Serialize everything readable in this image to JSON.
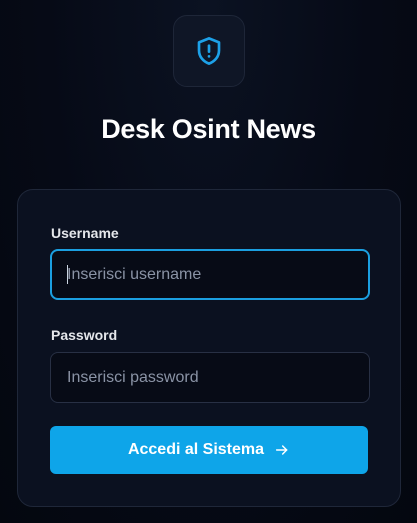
{
  "app": {
    "title": "Desk Osint News",
    "logo_icon": "shield-alert-icon",
    "accent_color": "#0ea5e9"
  },
  "login": {
    "username_label": "Username",
    "username_placeholder": "Inserisci username",
    "username_value": "",
    "password_label": "Password",
    "password_placeholder": "Inserisci password",
    "password_value": "",
    "submit_label": "Accedi al Sistema",
    "submit_icon": "arrow-right-icon"
  }
}
